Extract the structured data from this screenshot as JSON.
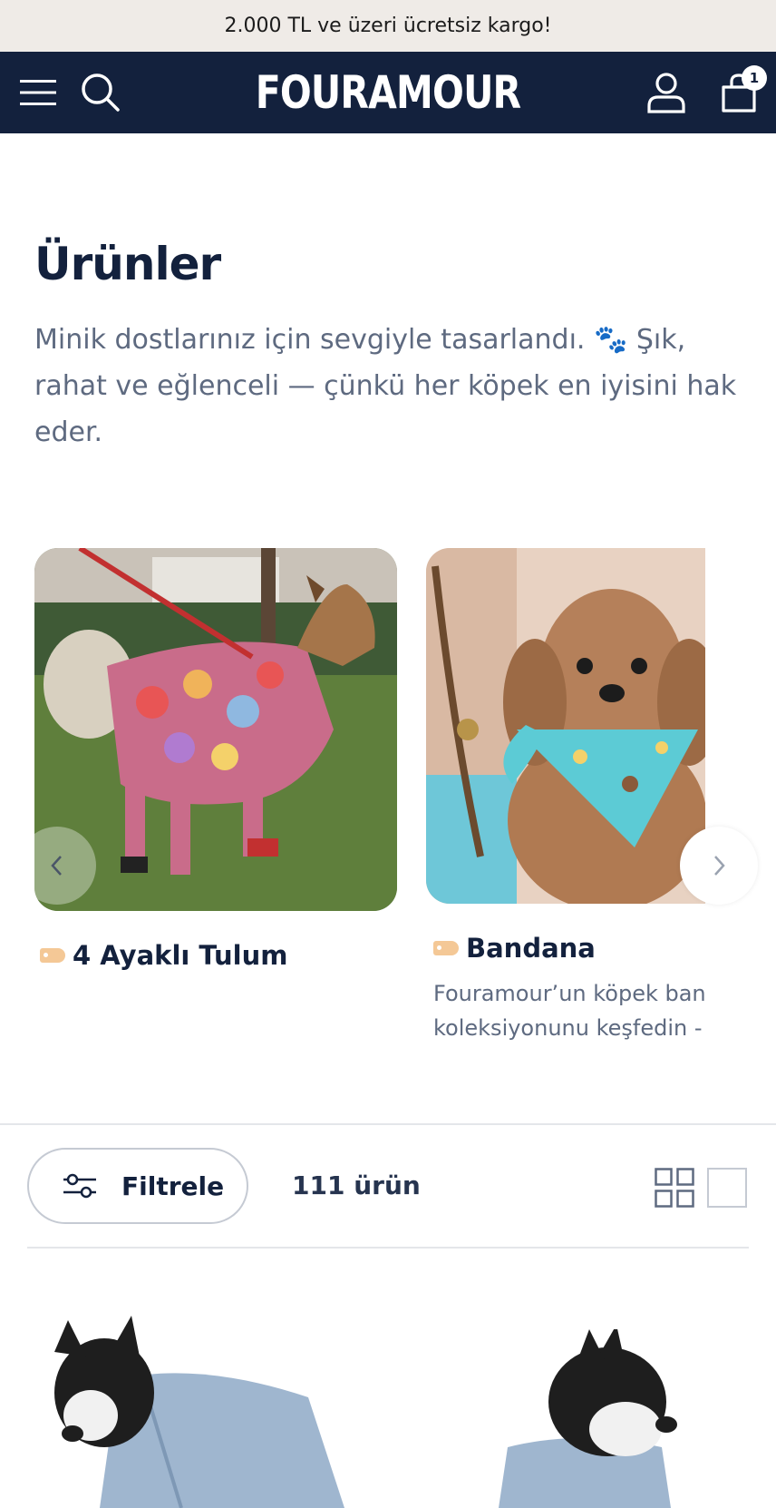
{
  "announcement": "2.000 TL ve üzeri ücretsiz kargo!",
  "header": {
    "logo": "FOURAMOUR",
    "cart_count": "1"
  },
  "collection": {
    "title": "Ürünler",
    "description": "Minik dostlarınız için sevgiyle tasarlandı. 🐾 Şık, rahat ve eğlenceli — çünkü her köpek en iyisini hak eder."
  },
  "categories": [
    {
      "title": "4 Ayaklı Tulum",
      "description": ""
    },
    {
      "title": "Bandana",
      "description_line1": "Fouramour’un köpek bandana",
      "description_line2": "koleksiyonunu keşfedin - şık"
    }
  ],
  "toolbar": {
    "filter_label": "Filtrele",
    "product_count": "111 ürün"
  },
  "colors": {
    "navy": "#13213d",
    "announcement_bg": "#efebe7",
    "muted_text": "#5e6a80",
    "tag": "#f4c896"
  }
}
